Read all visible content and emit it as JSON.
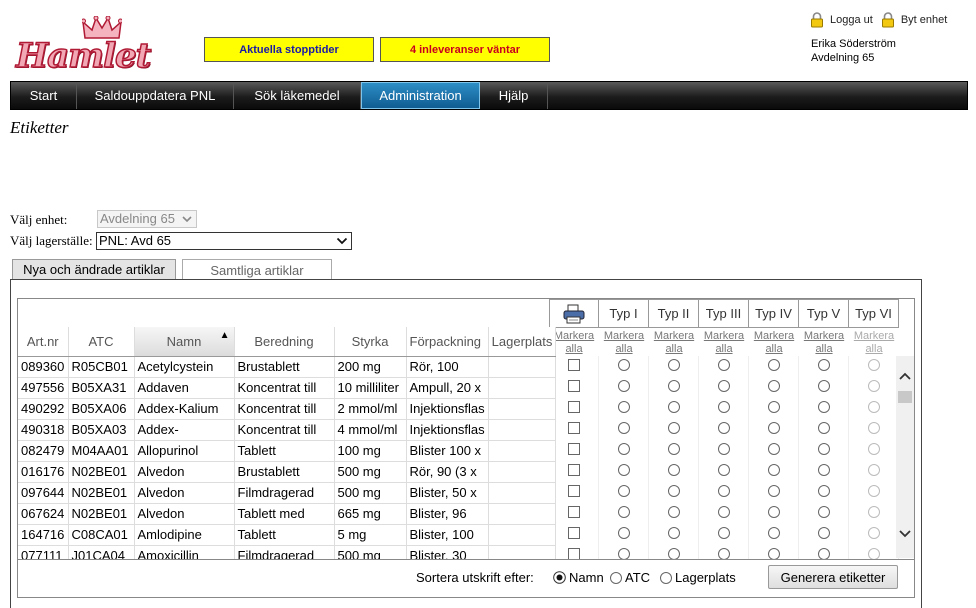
{
  "header": {
    "brand": "Hamlet",
    "alerts": [
      "Aktuella stopptider",
      "4 inleveranser väntar"
    ],
    "links": [
      "Logga ut",
      "Byt enhet"
    ],
    "user_name": "Erika Söderström",
    "department": "Avdelning 65"
  },
  "nav": {
    "items": [
      "Start",
      "Saldouppdatera PNL",
      "Sök läkemedel",
      "Administration",
      "Hjälp"
    ],
    "active": "Administration"
  },
  "page_title": "Etiketter",
  "filters": {
    "unit_label": "Välj enhet:",
    "unit_value": "Avdelning 65",
    "storage_label": "Välj lagerställe:",
    "storage_value": "PNL: Avd 65"
  },
  "tabs": [
    "Nya och ändrade artiklar",
    "Samtliga artiklar"
  ],
  "grid": {
    "columns": [
      "Art.nr",
      "ATC",
      "Namn",
      "Beredning",
      "Styrka",
      "Förpackning",
      "Lagerplats"
    ],
    "sorted_column": "Namn",
    "type_columns": [
      "Typ I",
      "Typ II",
      "Typ III",
      "Typ IV",
      "Typ V",
      "Typ VI"
    ],
    "mark_all": "Markera alla",
    "rows": [
      [
        "089360",
        "R05CB01",
        "Acetylcystein",
        "Brustablett",
        "200 mg",
        "Rör, 100",
        ""
      ],
      [
        "497556",
        "B05XA31",
        "Addaven",
        "Koncentrat till",
        "10 milliliter",
        "Ampull, 20 x",
        ""
      ],
      [
        "490292",
        "B05XA06",
        "Addex-Kalium",
        "Koncentrat till",
        "2 mmol/ml",
        "Injektionsflas",
        ""
      ],
      [
        "490318",
        "B05XA03",
        "Addex-",
        "Koncentrat till",
        "4 mmol/ml",
        "Injektionsflas",
        ""
      ],
      [
        "082479",
        "M04AA01",
        "Allopurinol",
        "Tablett",
        "100 mg",
        "Blister 100 x",
        ""
      ],
      [
        "016176",
        "N02BE01",
        "Alvedon",
        "Brustablett",
        "500 mg",
        "Rör, 90 (3 x",
        ""
      ],
      [
        "097644",
        "N02BE01",
        "Alvedon",
        "Filmdragerad",
        "500 mg",
        "Blister, 50 x",
        ""
      ],
      [
        "067624",
        "N02BE01",
        "Alvedon",
        "Tablett med",
        "665 mg",
        "Blister, 96",
        ""
      ],
      [
        "164716",
        "C08CA01",
        "Amlodipine",
        "Tablett",
        "5 mg",
        "Blister, 100",
        ""
      ],
      [
        "077111",
        "J01CA04",
        "Amoxicillin",
        "Filmdragerad",
        "500 mg",
        "Blister, 30",
        ""
      ]
    ]
  },
  "footer": {
    "sort_label": "Sortera utskrift efter:",
    "sort_options": [
      "Namn",
      "ATC",
      "Lagerplats"
    ],
    "sort_selected": "Namn",
    "generate_button": "Generera etiketter"
  }
}
